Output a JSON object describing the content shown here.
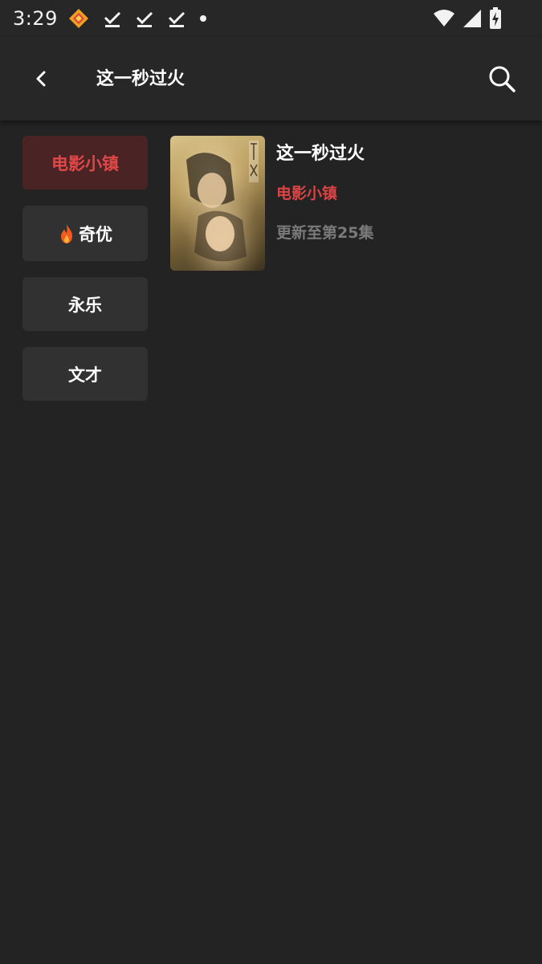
{
  "status_bar": {
    "time": "3:29",
    "left_icons": [
      "app-notification-icon",
      "download-done-icon",
      "download-done-icon",
      "download-done-icon",
      "dot-icon"
    ],
    "right_icons": [
      "wifi-icon",
      "signal-icon",
      "battery-charging-icon"
    ]
  },
  "app_bar": {
    "title": "这一秒过火"
  },
  "sources": [
    {
      "label": "电影小镇",
      "active": true,
      "hot": false
    },
    {
      "label": "奇优",
      "active": false,
      "hot": true
    },
    {
      "label": "永乐",
      "active": false,
      "hot": false
    },
    {
      "label": "文才",
      "active": false,
      "hot": false
    }
  ],
  "result": {
    "title": "这一秒过火",
    "source": "电影小镇",
    "update": "更新至第25集"
  },
  "colors": {
    "background": "#232323",
    "bar": "#272727",
    "accent": "#d94444",
    "active_item_bg": "#4a2424",
    "item_bg": "#313131"
  }
}
